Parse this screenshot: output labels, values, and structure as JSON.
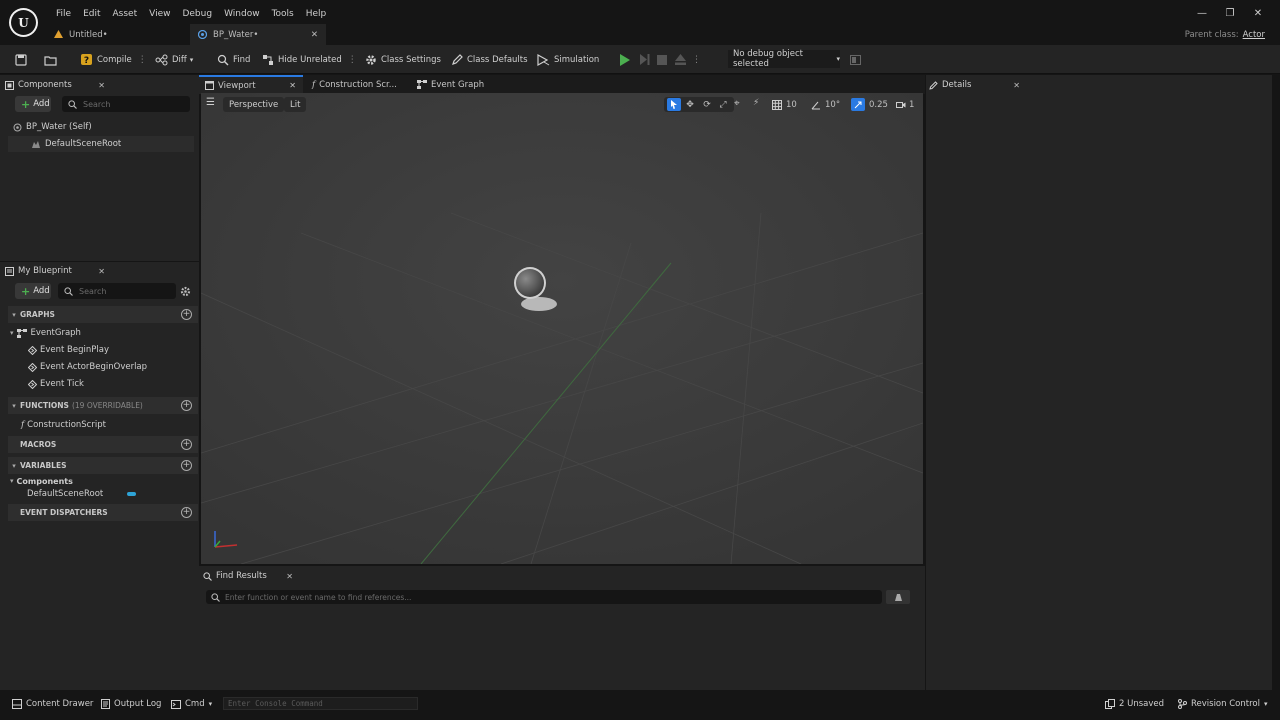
{
  "menubar": [
    "File",
    "Edit",
    "Asset",
    "View",
    "Debug",
    "Window",
    "Tools",
    "Help"
  ],
  "doc_tabs": [
    {
      "label": "Untitled•",
      "icon": "level-icon"
    },
    {
      "label": "BP_Water•",
      "icon": "blueprint-icon",
      "active": true
    }
  ],
  "parent_class": {
    "label": "Parent class:",
    "value": "Actor"
  },
  "toolbar": {
    "compile": "Compile",
    "diff": "Diff",
    "find": "Find",
    "hide_unrelated": "Hide Unrelated",
    "class_settings": "Class Settings",
    "class_defaults": "Class Defaults",
    "simulation": "Simulation",
    "debug_object": "No debug object selected"
  },
  "components": {
    "tab": "Components",
    "add": "Add",
    "search_placeholder": "Search",
    "self": "BP_Water (Self)",
    "root": "DefaultSceneRoot"
  },
  "my_blueprint": {
    "tab": "My Blueprint",
    "add": "Add",
    "search_placeholder": "Search",
    "graphs_label": "GRAPHS",
    "event_graph": "EventGraph",
    "events": [
      "Event BeginPlay",
      "Event ActorBeginOverlap",
      "Event Tick"
    ],
    "functions_label": "FUNCTIONS",
    "functions_count": "(19 OVERRIDABLE)",
    "construction_script": "ConstructionScript",
    "macros_label": "MACROS",
    "variables_label": "VARIABLES",
    "components_cat": "Components",
    "var_root": "DefaultSceneRoot",
    "dispatchers_label": "EVENT DISPATCHERS"
  },
  "editor_tabs": {
    "viewport": "Viewport",
    "construction": "Construction Scr...",
    "event_graph": "Event Graph"
  },
  "viewport": {
    "perspective": "Perspective",
    "lit": "Lit",
    "grid_snap": "10",
    "rot_snap": "10°",
    "scale_snap": "0.25",
    "camera_speed": "1"
  },
  "find_results": {
    "tab": "Find Results",
    "placeholder": "Enter function or event name to find references..."
  },
  "details": {
    "tab": "Details"
  },
  "statusbar": {
    "content_drawer": "Content Drawer",
    "output_log": "Output Log",
    "cmd": "Cmd",
    "console_placeholder": "Enter Console Command",
    "unsaved": "2 Unsaved",
    "revision": "Revision Control"
  },
  "colors": {
    "accent": "#2a7ae2",
    "play": "#4caf50",
    "variable_pill": "#2ea3d6"
  }
}
